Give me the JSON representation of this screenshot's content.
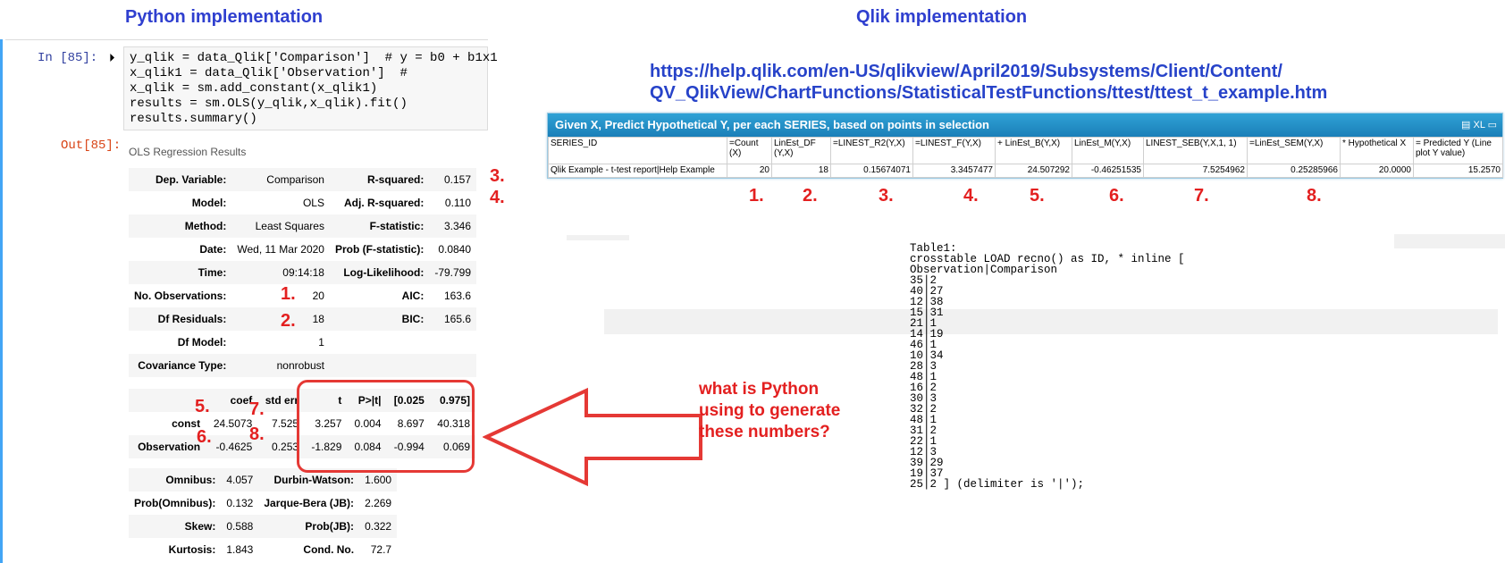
{
  "headings": {
    "python": "Python implementation",
    "qlik": "Qlik implementation"
  },
  "notebook": {
    "in_prompt": "In [85]:",
    "out_prompt": "Out[85]:",
    "run_icon": "step-run-icon",
    "code_lines": [
      "y_qlik = data_Qlik['Comparison']  # y = b0 + b1x1",
      "x_qlik1 = data_Qlik['Observation']  #",
      "x_qlik = sm.add_constant(x_qlik1)",
      "results = sm.OLS(y_qlik,x_qlik).fit()",
      "results.summary()"
    ],
    "summary_title": "OLS Regression Results"
  },
  "summary_rows": [
    {
      "l1": "Dep. Variable:",
      "v1": "Comparison",
      "l2": "R-squared:",
      "v2": "0.157"
    },
    {
      "l1": "Model:",
      "v1": "OLS",
      "l2": "Adj. R-squared:",
      "v2": "0.110"
    },
    {
      "l1": "Method:",
      "v1": "Least Squares",
      "l2": "F-statistic:",
      "v2": "3.346"
    },
    {
      "l1": "Date:",
      "v1": "Wed, 11 Mar 2020",
      "l2": "Prob (F-statistic):",
      "v2": "0.0840"
    },
    {
      "l1": "Time:",
      "v1": "09:14:18",
      "l2": "Log-Likelihood:",
      "v2": "-79.799"
    },
    {
      "l1": "No. Observations:",
      "v1": "20",
      "l2": "AIC:",
      "v2": "163.6"
    },
    {
      "l1": "Df Residuals:",
      "v1": "18",
      "l2": "BIC:",
      "v2": "165.6"
    },
    {
      "l1": "Df Model:",
      "v1": "1",
      "l2": "",
      "v2": ""
    },
    {
      "l1": "Covariance Type:",
      "v1": "nonrobust",
      "l2": "",
      "v2": ""
    }
  ],
  "coef_table": {
    "headers": [
      "coef",
      "std err",
      "t",
      "P>|t|",
      "[0.025",
      "0.975]"
    ],
    "rows": [
      {
        "name": "const",
        "values": [
          "24.5073",
          "7.525",
          "3.257",
          "0.004",
          "8.697",
          "40.318"
        ]
      },
      {
        "name": "Observation",
        "values": [
          "-0.4625",
          "0.253",
          "-1.829",
          "0.084",
          "-0.994",
          "0.069"
        ]
      }
    ]
  },
  "diag_rows": [
    {
      "l1": "Omnibus:",
      "v1": "4.057",
      "l2": "Durbin-Watson:",
      "v2": "1.600"
    },
    {
      "l1": "Prob(Omnibus):",
      "v1": "0.132",
      "l2": "Jarque-Bera (JB):",
      "v2": "2.269"
    },
    {
      "l1": "Skew:",
      "v1": "0.588",
      "l2": "Prob(JB):",
      "v2": "0.322"
    },
    {
      "l1": "Kurtosis:",
      "v1": "1.843",
      "l2": "Cond. No.",
      "v2": "72.7"
    }
  ],
  "annotations_left": {
    "n3": "3.",
    "n4": "4.",
    "n1": "1.",
    "n2": "2.",
    "n5": "5.",
    "n6": "6.",
    "n7": "7.",
    "n8": "8."
  },
  "link": {
    "line1": "https://help.qlik.com/en-US/qlikview/April2019/Subsystems/Client/Content/",
    "line2": "QV_QlikView/ChartFunctions/StatisticalTestFunctions/ttest/ttest_t_example.htm"
  },
  "qlik_table": {
    "title": "Given X, Predict Hypothetical Y, per each SERIES, based on points in selection",
    "toolbar": [
      "print-icon",
      "XL",
      "minimize-icon"
    ],
    "headers": [
      "SERIES_ID",
      "=Count (X)",
      "LinEst_DF (Y,X)",
      "=LINEST_R2(Y,X)",
      "=LINEST_F(Y,X)",
      "+ LinEst_B(Y,X)",
      "LinEst_M(Y,X)",
      "LINEST_SEB(Y,X,1, 1)",
      "=LinEst_SEM(Y,X)",
      "* Hypothetical X",
      "= Predicted Y (Line plot Y value)"
    ],
    "row": [
      "Qlik Example - t-test report|Help Example",
      "20",
      "18",
      "0.15674071",
      "3.3457477",
      "24.507292",
      "-0.46251535",
      "7.5254962",
      "0.25285966",
      "20.0000",
      "15.2570"
    ],
    "numbers": [
      "1.",
      "2.",
      "3.",
      "4.",
      "5.",
      "6.",
      "7.",
      "8."
    ]
  },
  "question": [
    "what is Python",
    "using to generate",
    "these numbers?"
  ],
  "script_lines": [
    "Table1:",
    "crosstable LOAD recno() as ID, * inline [",
    "Observation|Comparison",
    "35|2",
    "40|27",
    "12|38",
    "15|31",
    "21|1",
    "14|19",
    "46|1",
    "10|34",
    "28|3",
    "48|1",
    "16|2",
    "30|3",
    "32|2",
    "48|1",
    "31|2",
    "22|1",
    "12|3",
    "39|29",
    "19|37",
    "25|2 ] (delimiter is '|');"
  ],
  "colors": {
    "heading": "#2f3fcf",
    "annotation": "#e32020",
    "qlik_title": "#1b7fb8"
  }
}
